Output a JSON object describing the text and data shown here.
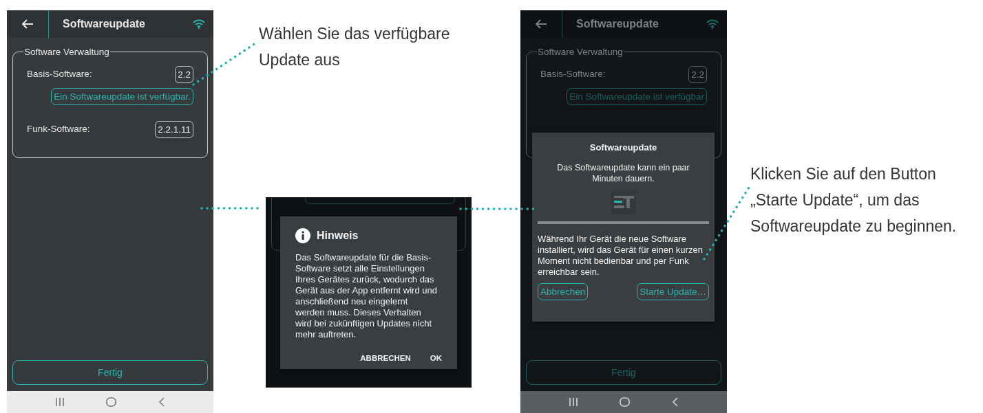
{
  "panels": [
    {
      "kind": "phone",
      "dimmed": false,
      "title": "Softwareupdate",
      "group_title": "Software Verwaltung",
      "rows": [
        {
          "label": "Basis-Software:",
          "value": "2.2"
        },
        {
          "label": "Funk-Software:",
          "value": "2.2.1.11"
        }
      ],
      "update_link": "Ein Softwareupdate ist verfügbar.",
      "done_button": "Fertig"
    },
    {
      "kind": "dialog",
      "title": "Hinweis",
      "message": "Das Softwareupdate für die Basis-Software setzt alle Einstellungen Ihres Gerätes zurück, wodurch das Gerät aus der App entfernt wird und anschließend neu eingelernt werden muss. Dieses Verhalten wird bei zukünftigen Updates nicht mehr auftreten.",
      "buttons": [
        "ABBRECHEN",
        "OK"
      ]
    },
    {
      "kind": "phone",
      "dimmed": true,
      "title": "Softwareupdate",
      "group_title": "Software Verwaltung",
      "rows": [
        {
          "label": "Basis-Software:",
          "value": "2.2"
        }
      ],
      "update_link": "Ein Softwareupdate ist verfügbar",
      "done_button": "Fertig",
      "dialog": {
        "title": "Softwareupdate",
        "message": "Das Softwareupdate kann ein paar Minuten dauern.",
        "note": "Während Ihr Gerät die neue Software installiert, wird das Gerät für einen kurzen Moment nicht bedienbar und per Funk erreichbar sein.",
        "buttons": [
          "Abbrechen",
          "Starte Update…"
        ]
      }
    }
  ],
  "callouts": [
    {
      "text": "Wählen Sie das verfügbare Update aus"
    },
    {
      "text": "Klicken Sie auf den Button „Starte Update“, um das Softwareupdate zu beginnen."
    }
  ]
}
